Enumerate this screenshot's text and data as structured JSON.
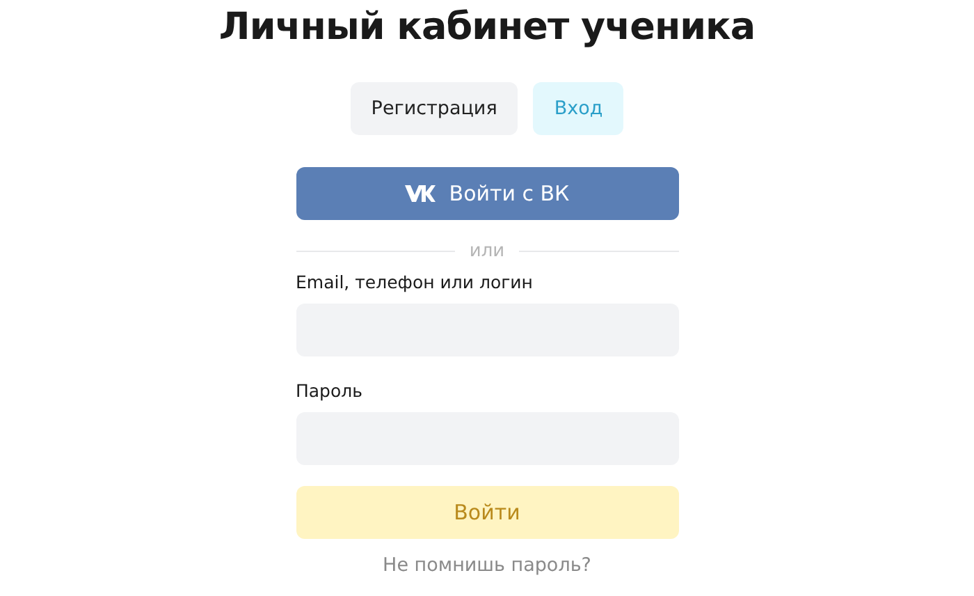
{
  "title": "Личный кабинет ученика",
  "tabs": [
    {
      "label": "Регистрация",
      "selected": false
    },
    {
      "label": "Вход",
      "selected": true
    }
  ],
  "vk_button": "Войти с ВК",
  "divider": "или",
  "fields": [
    {
      "label": "Email, телефон или логин"
    },
    {
      "label": "Пароль"
    }
  ],
  "submit": "Войти",
  "forgot_link": "Не помнишь пароль?"
}
